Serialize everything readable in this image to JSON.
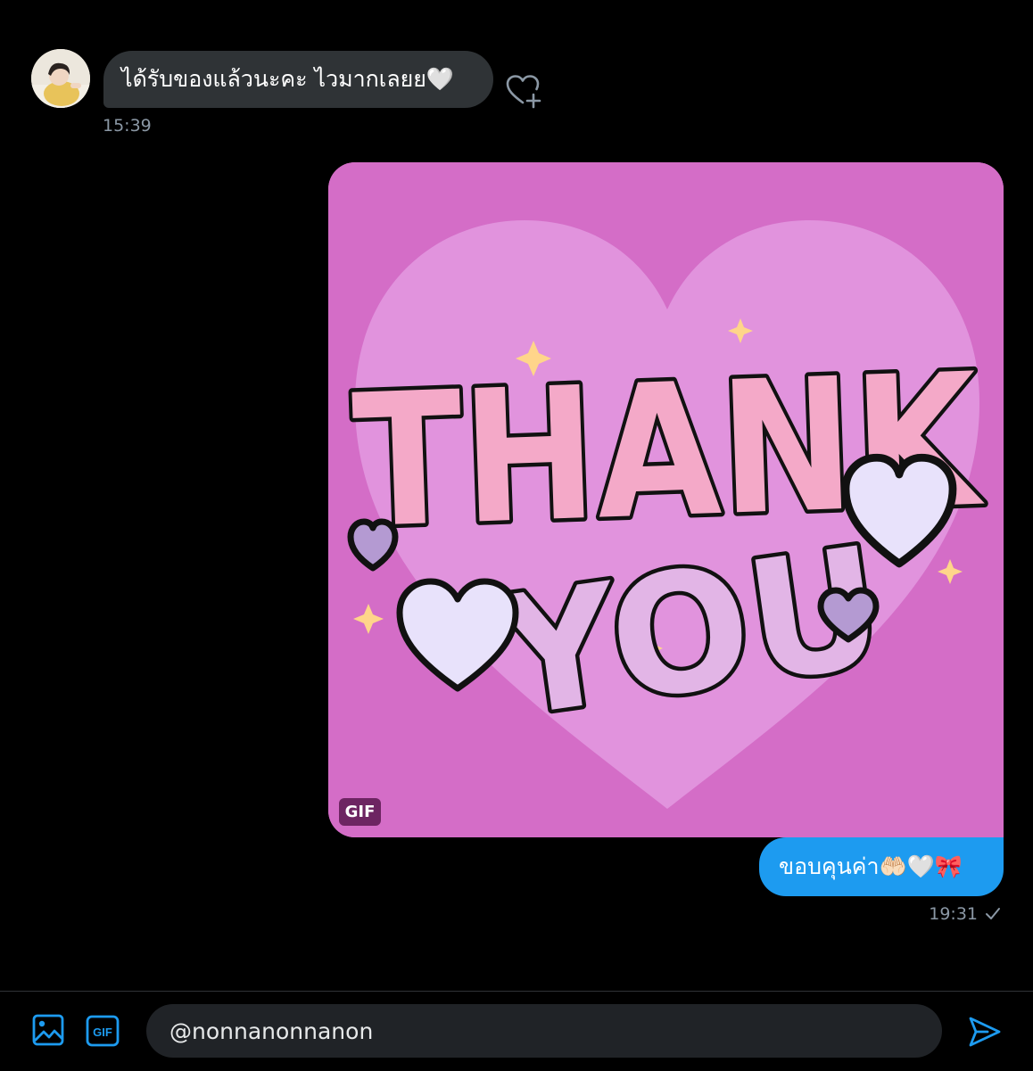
{
  "incoming": {
    "message": "ได้รับของแล้วนะคะ ไวมากเลยย🤍",
    "time": "15:39"
  },
  "gif": {
    "badge": "GIF",
    "art_words": [
      "THANK",
      "YOU"
    ]
  },
  "outgoing": {
    "message": "ขอบคุนค่า🤲🏻🤍🎀",
    "time": "19:31",
    "status_icon": "check-icon"
  },
  "composer": {
    "value": "@nonnanonnanon",
    "gif_button": "GIF"
  },
  "colors": {
    "accent": "#1d9bf0",
    "gif_background": "#d46dc7",
    "incoming_bubble": "#2f3336"
  }
}
